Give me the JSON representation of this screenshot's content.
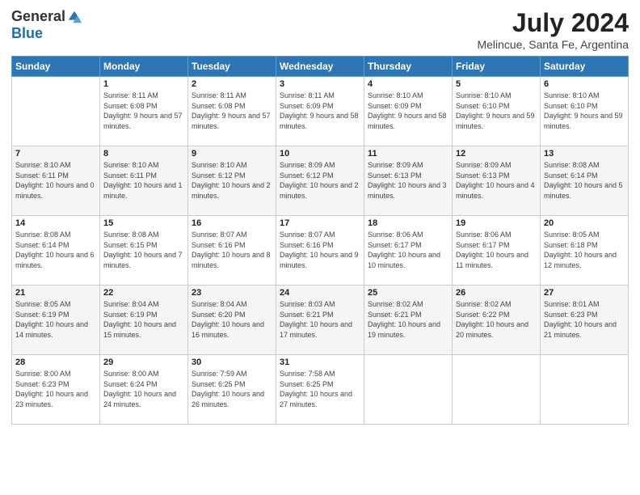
{
  "logo": {
    "general": "General",
    "blue": "Blue"
  },
  "title": "July 2024",
  "subtitle": "Melincue, Santa Fe, Argentina",
  "days_of_week": [
    "Sunday",
    "Monday",
    "Tuesday",
    "Wednesday",
    "Thursday",
    "Friday",
    "Saturday"
  ],
  "weeks": [
    [
      {
        "day": "",
        "sunrise": "",
        "sunset": "",
        "daylight": ""
      },
      {
        "day": "1",
        "sunrise": "Sunrise: 8:11 AM",
        "sunset": "Sunset: 6:08 PM",
        "daylight": "Daylight: 9 hours and 57 minutes."
      },
      {
        "day": "2",
        "sunrise": "Sunrise: 8:11 AM",
        "sunset": "Sunset: 6:08 PM",
        "daylight": "Daylight: 9 hours and 57 minutes."
      },
      {
        "day": "3",
        "sunrise": "Sunrise: 8:11 AM",
        "sunset": "Sunset: 6:09 PM",
        "daylight": "Daylight: 9 hours and 58 minutes."
      },
      {
        "day": "4",
        "sunrise": "Sunrise: 8:10 AM",
        "sunset": "Sunset: 6:09 PM",
        "daylight": "Daylight: 9 hours and 58 minutes."
      },
      {
        "day": "5",
        "sunrise": "Sunrise: 8:10 AM",
        "sunset": "Sunset: 6:10 PM",
        "daylight": "Daylight: 9 hours and 59 minutes."
      },
      {
        "day": "6",
        "sunrise": "Sunrise: 8:10 AM",
        "sunset": "Sunset: 6:10 PM",
        "daylight": "Daylight: 9 hours and 59 minutes."
      }
    ],
    [
      {
        "day": "7",
        "sunrise": "Sunrise: 8:10 AM",
        "sunset": "Sunset: 6:11 PM",
        "daylight": "Daylight: 10 hours and 0 minutes."
      },
      {
        "day": "8",
        "sunrise": "Sunrise: 8:10 AM",
        "sunset": "Sunset: 6:11 PM",
        "daylight": "Daylight: 10 hours and 1 minute."
      },
      {
        "day": "9",
        "sunrise": "Sunrise: 8:10 AM",
        "sunset": "Sunset: 6:12 PM",
        "daylight": "Daylight: 10 hours and 2 minutes."
      },
      {
        "day": "10",
        "sunrise": "Sunrise: 8:09 AM",
        "sunset": "Sunset: 6:12 PM",
        "daylight": "Daylight: 10 hours and 2 minutes."
      },
      {
        "day": "11",
        "sunrise": "Sunrise: 8:09 AM",
        "sunset": "Sunset: 6:13 PM",
        "daylight": "Daylight: 10 hours and 3 minutes."
      },
      {
        "day": "12",
        "sunrise": "Sunrise: 8:09 AM",
        "sunset": "Sunset: 6:13 PM",
        "daylight": "Daylight: 10 hours and 4 minutes."
      },
      {
        "day": "13",
        "sunrise": "Sunrise: 8:08 AM",
        "sunset": "Sunset: 6:14 PM",
        "daylight": "Daylight: 10 hours and 5 minutes."
      }
    ],
    [
      {
        "day": "14",
        "sunrise": "Sunrise: 8:08 AM",
        "sunset": "Sunset: 6:14 PM",
        "daylight": "Daylight: 10 hours and 6 minutes."
      },
      {
        "day": "15",
        "sunrise": "Sunrise: 8:08 AM",
        "sunset": "Sunset: 6:15 PM",
        "daylight": "Daylight: 10 hours and 7 minutes."
      },
      {
        "day": "16",
        "sunrise": "Sunrise: 8:07 AM",
        "sunset": "Sunset: 6:16 PM",
        "daylight": "Daylight: 10 hours and 8 minutes."
      },
      {
        "day": "17",
        "sunrise": "Sunrise: 8:07 AM",
        "sunset": "Sunset: 6:16 PM",
        "daylight": "Daylight: 10 hours and 9 minutes."
      },
      {
        "day": "18",
        "sunrise": "Sunrise: 8:06 AM",
        "sunset": "Sunset: 6:17 PM",
        "daylight": "Daylight: 10 hours and 10 minutes."
      },
      {
        "day": "19",
        "sunrise": "Sunrise: 8:06 AM",
        "sunset": "Sunset: 6:17 PM",
        "daylight": "Daylight: 10 hours and 11 minutes."
      },
      {
        "day": "20",
        "sunrise": "Sunrise: 8:05 AM",
        "sunset": "Sunset: 6:18 PM",
        "daylight": "Daylight: 10 hours and 12 minutes."
      }
    ],
    [
      {
        "day": "21",
        "sunrise": "Sunrise: 8:05 AM",
        "sunset": "Sunset: 6:19 PM",
        "daylight": "Daylight: 10 hours and 14 minutes."
      },
      {
        "day": "22",
        "sunrise": "Sunrise: 8:04 AM",
        "sunset": "Sunset: 6:19 PM",
        "daylight": "Daylight: 10 hours and 15 minutes."
      },
      {
        "day": "23",
        "sunrise": "Sunrise: 8:04 AM",
        "sunset": "Sunset: 6:20 PM",
        "daylight": "Daylight: 10 hours and 16 minutes."
      },
      {
        "day": "24",
        "sunrise": "Sunrise: 8:03 AM",
        "sunset": "Sunset: 6:21 PM",
        "daylight": "Daylight: 10 hours and 17 minutes."
      },
      {
        "day": "25",
        "sunrise": "Sunrise: 8:02 AM",
        "sunset": "Sunset: 6:21 PM",
        "daylight": "Daylight: 10 hours and 19 minutes."
      },
      {
        "day": "26",
        "sunrise": "Sunrise: 8:02 AM",
        "sunset": "Sunset: 6:22 PM",
        "daylight": "Daylight: 10 hours and 20 minutes."
      },
      {
        "day": "27",
        "sunrise": "Sunrise: 8:01 AM",
        "sunset": "Sunset: 6:23 PM",
        "daylight": "Daylight: 10 hours and 21 minutes."
      }
    ],
    [
      {
        "day": "28",
        "sunrise": "Sunrise: 8:00 AM",
        "sunset": "Sunset: 6:23 PM",
        "daylight": "Daylight: 10 hours and 23 minutes."
      },
      {
        "day": "29",
        "sunrise": "Sunrise: 8:00 AM",
        "sunset": "Sunset: 6:24 PM",
        "daylight": "Daylight: 10 hours and 24 minutes."
      },
      {
        "day": "30",
        "sunrise": "Sunrise: 7:59 AM",
        "sunset": "Sunset: 6:25 PM",
        "daylight": "Daylight: 10 hours and 26 minutes."
      },
      {
        "day": "31",
        "sunrise": "Sunrise: 7:58 AM",
        "sunset": "Sunset: 6:25 PM",
        "daylight": "Daylight: 10 hours and 27 minutes."
      },
      {
        "day": "",
        "sunrise": "",
        "sunset": "",
        "daylight": ""
      },
      {
        "day": "",
        "sunrise": "",
        "sunset": "",
        "daylight": ""
      },
      {
        "day": "",
        "sunrise": "",
        "sunset": "",
        "daylight": ""
      }
    ]
  ]
}
